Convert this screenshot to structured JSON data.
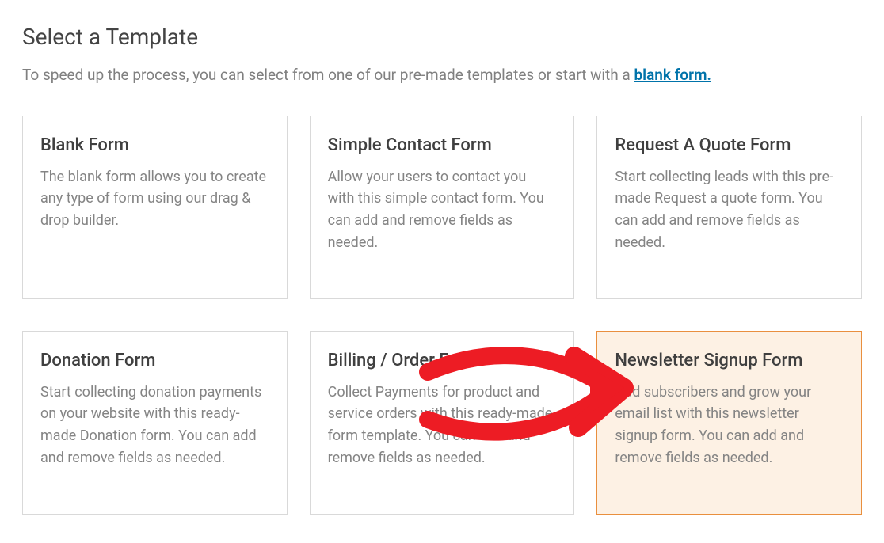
{
  "header": {
    "title": "Select a Template",
    "subtitle_prefix": "To speed up the process, you can select from one of our pre-made templates or start with a ",
    "blank_link_label": "blank form."
  },
  "templates": [
    {
      "title": "Blank Form",
      "desc": "The blank form allows you to create any type of form using our drag & drop builder.",
      "highlight": false
    },
    {
      "title": "Simple Contact Form",
      "desc": "Allow your users to contact you with this simple contact form. You can add and remove fields as needed.",
      "highlight": false
    },
    {
      "title": "Request A Quote Form",
      "desc": "Start collecting leads with this pre-made Request a quote form. You can add and remove fields as needed.",
      "highlight": false
    },
    {
      "title": "Donation Form",
      "desc": "Start collecting donation payments on your website with this ready-made Donation form. You can add and remove fields as needed.",
      "highlight": false
    },
    {
      "title": "Billing / Order Form",
      "desc": "Collect Payments for product and service orders with this ready-made form template. You can add and remove fields as needed.",
      "highlight": false
    },
    {
      "title": "Newsletter Signup Form",
      "desc": "Add subscribers and grow your email list with this newsletter signup form. You can add and remove fields as needed.",
      "highlight": true
    }
  ]
}
